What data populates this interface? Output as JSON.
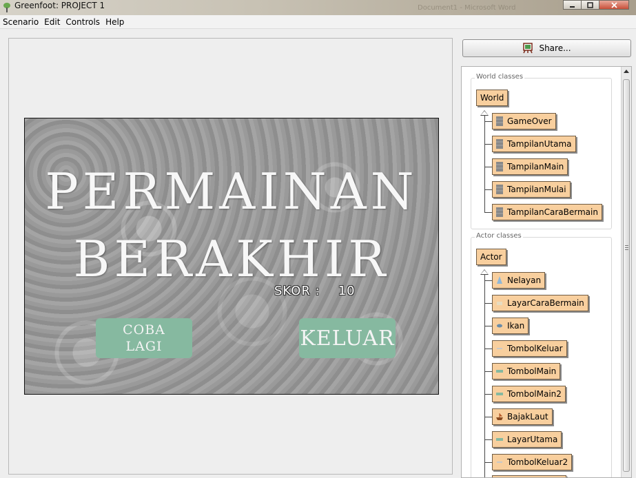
{
  "window": {
    "title": "Greenfoot: PROJECT 1",
    "background_text": "Document1 - Microsoft Word"
  },
  "menu": [
    "Scenario",
    "Edit",
    "Controls",
    "Help"
  ],
  "world": {
    "title_line1": "PERMAINAN",
    "title_line2": "BERAKHIR",
    "score_label": "SKOR :",
    "score_value": "10",
    "retry_line1": "COBA",
    "retry_line2": "LAGI",
    "exit_label": "KELUAR"
  },
  "share": {
    "label": "Share..."
  },
  "world_classes": {
    "label": "World classes",
    "root": "World",
    "items": [
      "GameOver",
      "TampilanUtama",
      "TampilanMain",
      "TampilanMulai",
      "TampilanCaraBermain"
    ]
  },
  "actor_classes": {
    "label": "Actor classes",
    "root": "Actor",
    "items": [
      {
        "name": "Nelayan",
        "icon": "fisherman-icon"
      },
      {
        "name": "LayarCaraBermain",
        "icon": "screen-icon"
      },
      {
        "name": "Ikan",
        "icon": "fish-icon"
      },
      {
        "name": "TombolKeluar",
        "icon": "button-icon"
      },
      {
        "name": "TombolMain",
        "icon": "button-icon"
      },
      {
        "name": "TombolMain2",
        "icon": "button-icon"
      },
      {
        "name": "BajakLaut",
        "icon": "ship-icon"
      },
      {
        "name": "LayarUtama",
        "icon": "screen-icon"
      },
      {
        "name": "TombolKeluar2",
        "icon": "button-icon"
      }
    ]
  },
  "colors": {
    "class_fill": "#f8cf9e",
    "game_button": "#86b9a0"
  }
}
